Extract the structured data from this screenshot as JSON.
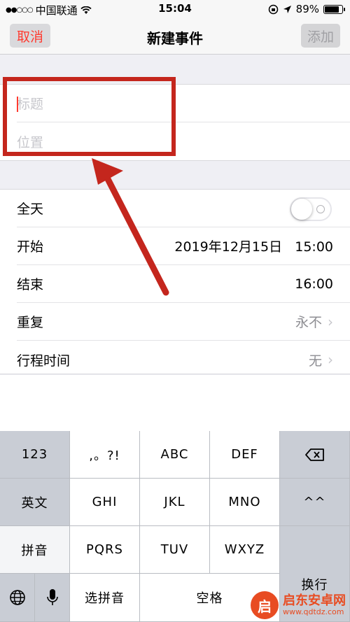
{
  "status_bar": {
    "signal_dots": "●●○○○",
    "carrier": "中国联通",
    "wifi_icon": "wifi-icon",
    "time": "15:04",
    "battery_percent": "89%",
    "battery_level": 0.89
  },
  "nav": {
    "cancel_label": "取消",
    "title": "新建事件",
    "add_label": "添加"
  },
  "form": {
    "title_placeholder": "标题",
    "location_placeholder": "位置"
  },
  "details": {
    "all_day_label": "全天",
    "all_day_on": false,
    "start_label": "开始",
    "start_date": "2019年12月15日",
    "start_time": "15:00",
    "end_label": "结束",
    "end_time": "16:00",
    "repeat_label": "重复",
    "repeat_value": "永不",
    "travel_label": "行程时间",
    "travel_value": "无"
  },
  "keyboard": {
    "k_123": "123",
    "k_punct": ",。?!",
    "k_abc": "ABC",
    "k_def": "DEF",
    "k_english": "英文",
    "k_ghi": "GHI",
    "k_jkl": "JKL",
    "k_mno": "MNO",
    "k_emoji": "^^",
    "k_pinyin": "拼音",
    "k_pqrs": "PQRS",
    "k_tuv": "TUV",
    "k_wxyz": "WXYZ",
    "k_return": "换行",
    "k_select_pinyin": "选拼音",
    "k_space": "空格"
  },
  "watermark": {
    "name": "启东安卓网",
    "url": "www.qdtdz.com",
    "logo_glyph": "启"
  },
  "colors": {
    "accent_red": "#ff3b30",
    "annotation_red": "#c4261d"
  }
}
